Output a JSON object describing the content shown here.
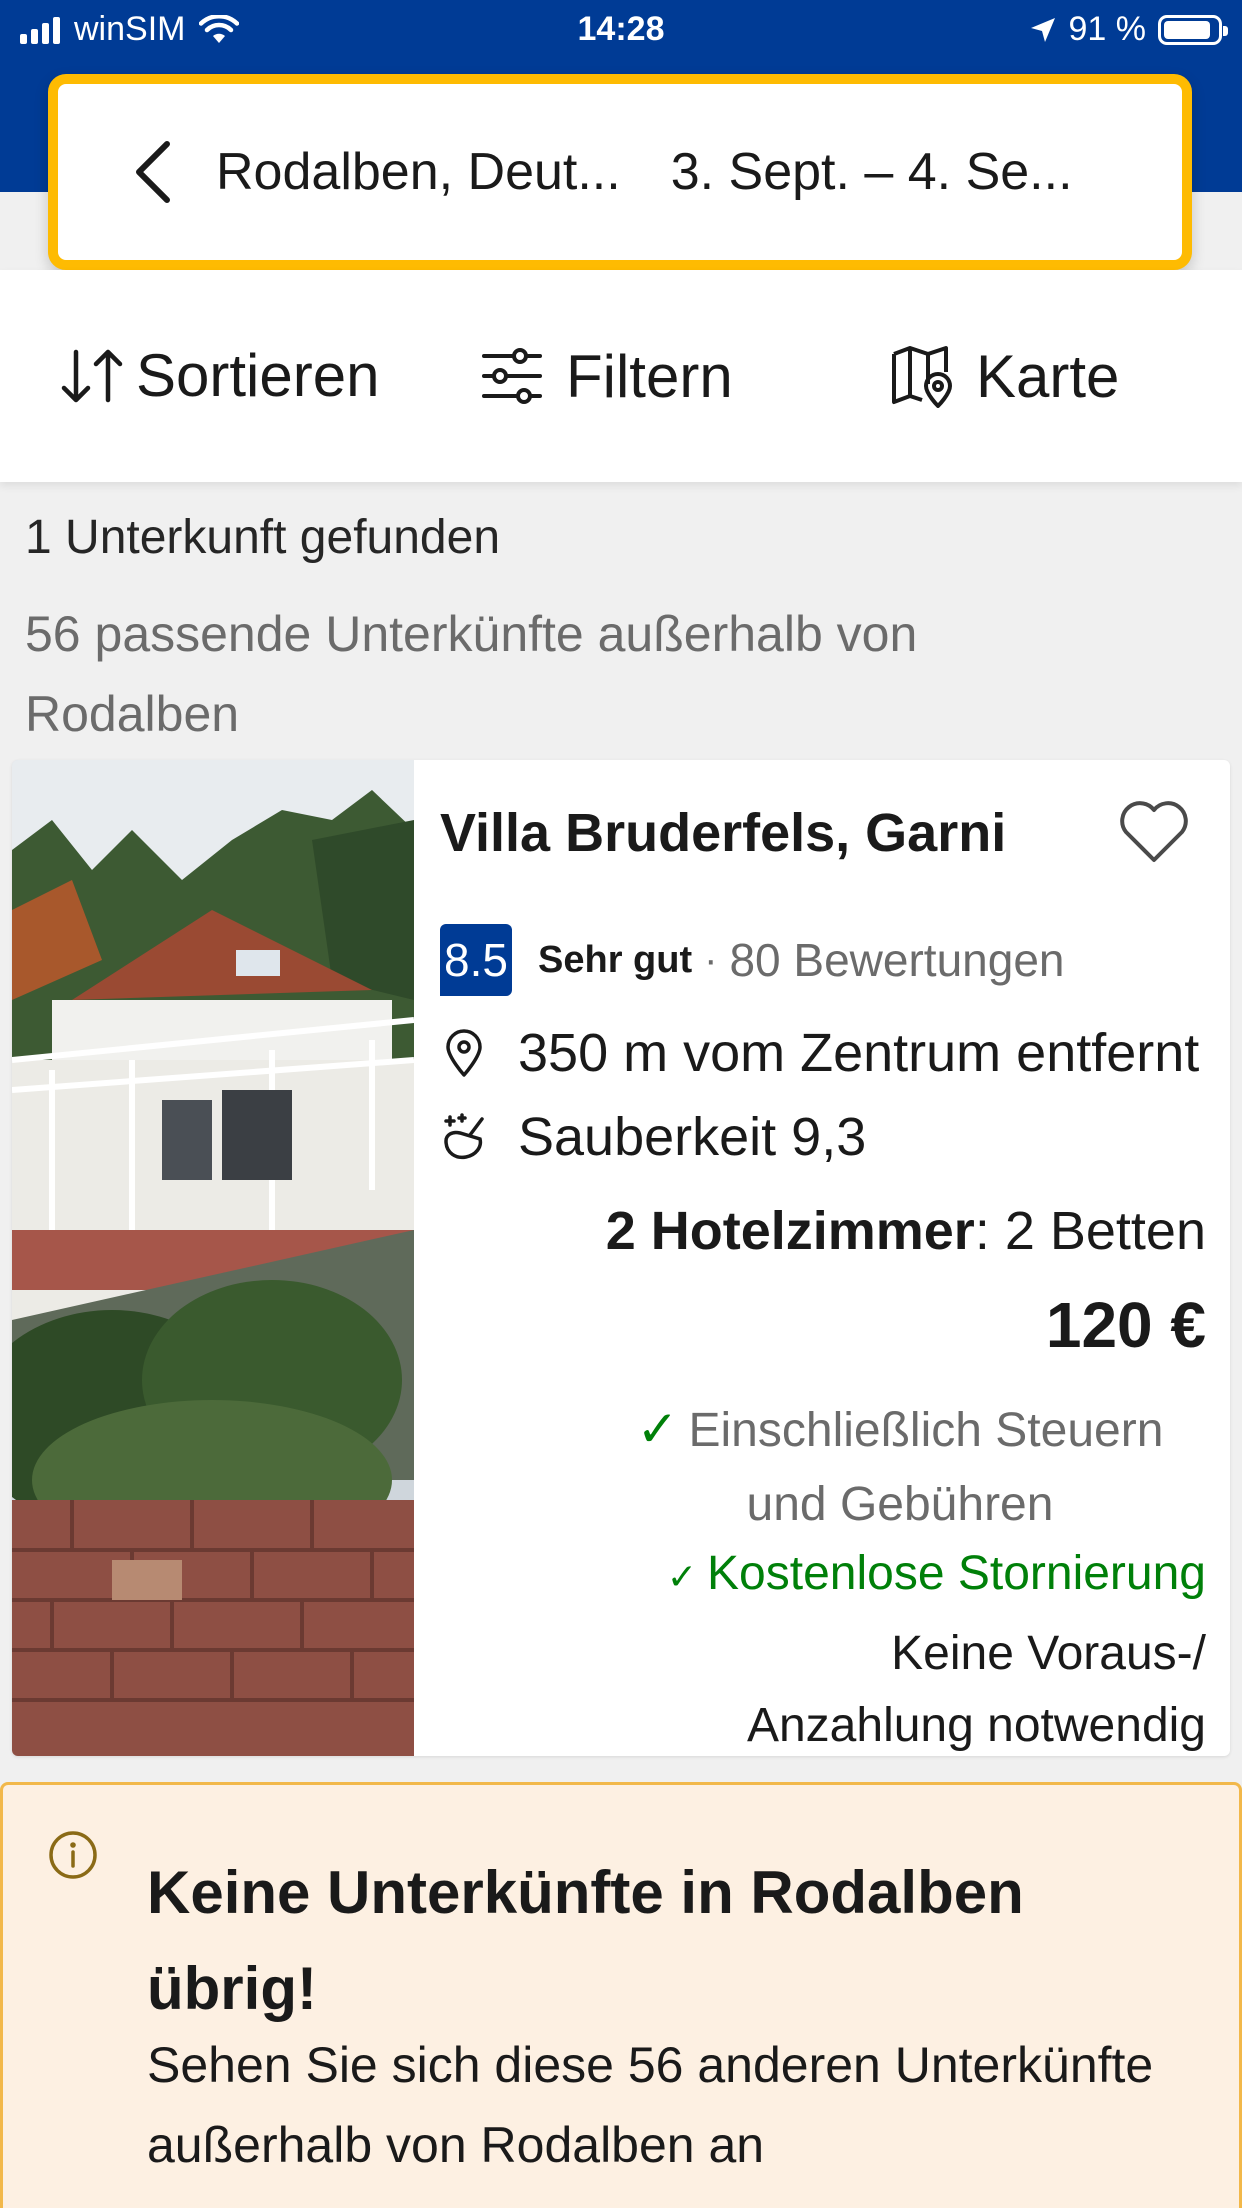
{
  "status_bar": {
    "carrier": "winSIM",
    "time": "14:28",
    "battery": "91 %"
  },
  "search": {
    "destination": "Rodalben, Deut...",
    "dates": "3. Sept.  –  4. Se..."
  },
  "toolbar": {
    "sort_label": "Sortieren",
    "filter_label": "Filtern",
    "map_label": "Karte"
  },
  "results": {
    "count_text": "1 Unterkunft gefunden",
    "outside_text": "56 passende Unterkünfte außerhalb von Rodalben"
  },
  "property": {
    "name": "Villa Bruderfels, Garni",
    "score": "8.5",
    "rating_word": "Sehr gut",
    "separator": "·",
    "reviews": "80 Bewertungen",
    "distance": "350 m vom Zentrum entfernt",
    "cleanliness": "Sauberkeit 9,3",
    "room_type": "2 Hotelzimmer",
    "room_beds": ": 2 Betten",
    "price": "120 €",
    "tax_check": "✓",
    "tax_note": "Einschließlich Steuern und Gebühren",
    "free_cancel_check": "✓",
    "free_cancel": "Kostenlose Stornierung",
    "no_prepay": "Keine Voraus-/ Anzahlung notwendig"
  },
  "warning": {
    "title": "Keine Unterkünfte in Rodalben übrig!",
    "text": "Sehen Sie sich diese 56 anderen Unterkünfte außerhalb von Rodalben an"
  },
  "colors": {
    "brand_blue": "#003b95",
    "search_border": "#febb02",
    "success_green": "#008009",
    "warning_bg": "#fdf0e2"
  },
  "icons": [
    "signal-icon",
    "wifi-icon",
    "location-arrow-icon",
    "battery-icon",
    "back-chevron-icon",
    "sort-icon",
    "filter-icon",
    "map-icon",
    "heart-icon",
    "map-pin-icon",
    "cleanliness-icon",
    "info-icon"
  ]
}
